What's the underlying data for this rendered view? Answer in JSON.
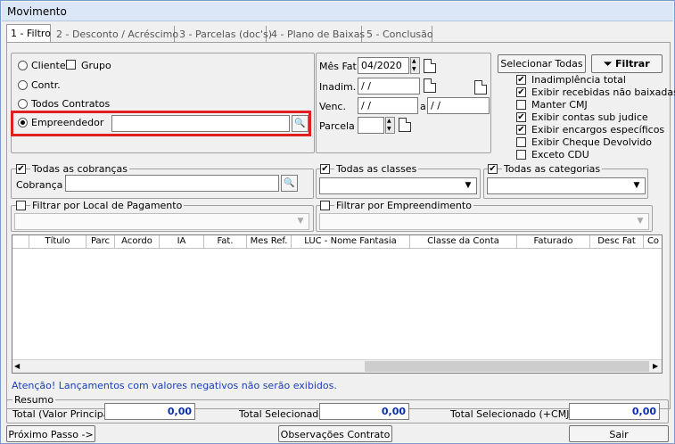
{
  "window": {
    "title": "Movimento"
  },
  "tabs": [
    {
      "label": "1 - Filtro"
    },
    {
      "label": "2 - Desconto / Acréscimo"
    },
    {
      "label": "3 - Parcelas (doc's)"
    },
    {
      "label": "4 - Plano de Baixas"
    },
    {
      "label": "5 - Conclusão"
    }
  ],
  "selection": {
    "cliente": "Cliente",
    "grupo": "Grupo",
    "contr": "Contr.",
    "todos_contratos": "Todos Contratos",
    "empreendedor": "Empreendedor",
    "empreendedor_value": ""
  },
  "dates": {
    "mes_fat_label": "Mês Fat.",
    "mes_fat_value": "04/2020",
    "inadim_label": "Inadim.",
    "inadim_value": " / /",
    "venc_label": "Venc.",
    "venc_from": " / /",
    "venc_sep": "a",
    "venc_to": " / /",
    "parcela_label": "Parcela",
    "parcela_value": ""
  },
  "buttons": {
    "selecionar_todas": "Selecionar Todas",
    "filtrar": "Filtrar",
    "proximo": "Próximo Passo ->",
    "observacoes": "Observações Contrato",
    "sair": "Sair"
  },
  "options": [
    {
      "label": "Inadimplência total",
      "checked": true
    },
    {
      "label": "Exibir recebidas não baixadas",
      "checked": true
    },
    {
      "label": "Manter CMJ",
      "checked": false
    },
    {
      "label": "Exibir contas sub judice",
      "checked": true
    },
    {
      "label": "Exibir encargos específicos",
      "checked": true
    },
    {
      "label": "Exibir Cheque Devolvido",
      "checked": false
    },
    {
      "label": "Exceto CDU",
      "checked": false
    }
  ],
  "filters": {
    "todas_cobrancas": "Todas as cobranças",
    "cobranca_label": "Cobrança",
    "cobranca_value": "",
    "todas_classes": "Todas as classes",
    "todas_categorias": "Todas as categorias",
    "local_pagamento": "Filtrar por Local de Pagamento",
    "empreendimento": "Filtrar por Empreendimento"
  },
  "grid": {
    "columns": [
      "",
      "Título",
      "Parc",
      "Acordo",
      "IA",
      "Fat.",
      "Mes Ref.",
      "LUC - Nome Fantasia",
      "Classe da Conta",
      "Faturado",
      "Desc Fat",
      "Co"
    ]
  },
  "warning": "Atenção! Lançamentos com valores negativos não serão exibidos.",
  "resumo": {
    "title": "Resumo",
    "total_principal_label": "Total (Valor Principal)",
    "total_principal_value": "0,00",
    "total_selecionado_label": "Total Selecionado",
    "total_selecionado_value": "0,00",
    "total_cmjd_label": "Total Selecionado (+CMJD)",
    "total_cmjd_value": "0,00"
  },
  "colors": {
    "highlight": "#e02020",
    "value_text": "#0a2ea8",
    "warning_text": "#1a3fb5"
  }
}
